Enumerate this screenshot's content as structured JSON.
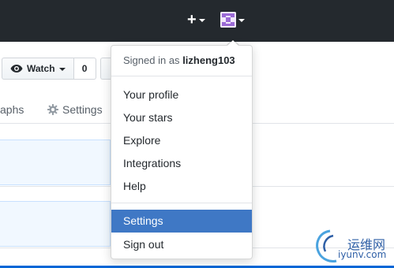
{
  "header": {
    "new_menu_icon": "plus-icon",
    "avatar_icon": "identicon-avatar"
  },
  "repo_actions": {
    "watch_label": "Watch",
    "watch_count": "0"
  },
  "tabs": {
    "graphs_label": "aphs",
    "settings_label": "Settings"
  },
  "user_menu": {
    "signed_in_prefix": "Signed in as",
    "username": "lizheng103",
    "items": [
      {
        "label": "Your profile"
      },
      {
        "label": "Your stars"
      },
      {
        "label": "Explore"
      },
      {
        "label": "Integrations"
      },
      {
        "label": "Help"
      },
      {
        "label": "Settings"
      },
      {
        "label": "Sign out"
      }
    ],
    "active_item": "Settings"
  },
  "watermark": {
    "name": "运维网",
    "url": "iyunv.com"
  },
  "colors": {
    "header_bg": "#24292e",
    "menu_highlight": "#3f78c5",
    "avatar_purple": "#9b6ad6",
    "link_blue": "#0366d6"
  }
}
